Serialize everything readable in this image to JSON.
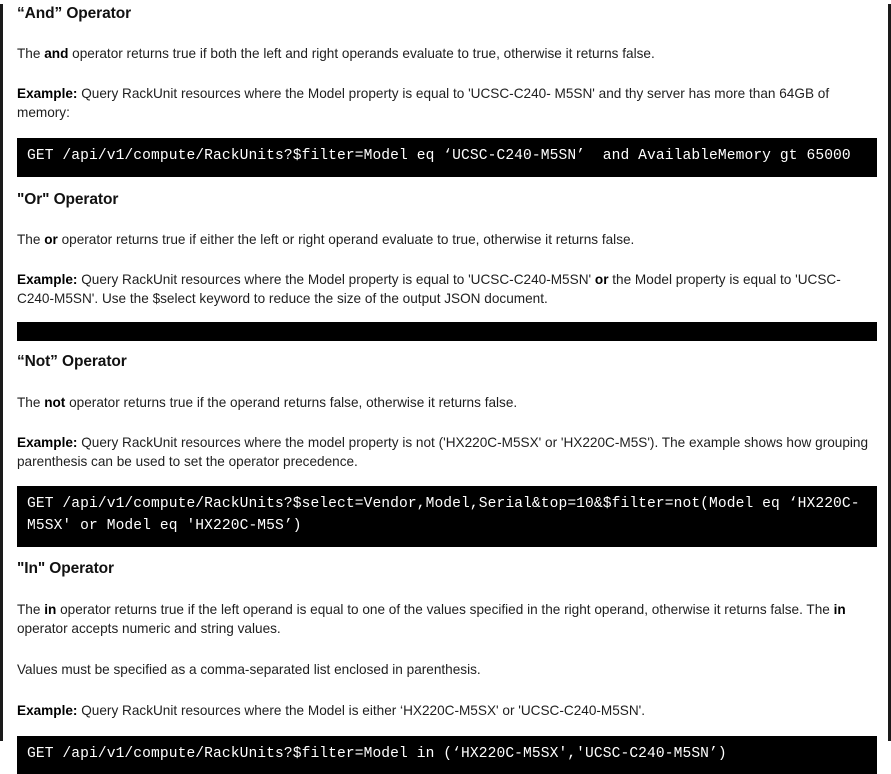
{
  "document": {
    "sections": [
      {
        "id": "and",
        "heading": "“And” Operator",
        "description_prefix": "The ",
        "description_operator": "and",
        "description_suffix": " operator returns true if both the left and right operands evaluate to true, otherwise it returns false.",
        "example_label": "Example:",
        "example_text": " Query RackUnit resources where the Model property is equal to 'UCSC-C240- M5SN' and thy server has more than 64GB of memory:",
        "code": "GET /api/v1/compute/RackUnits?$filter=Model eq ‘UCSC-C240-M5SN’  and AvailableMemory gt 65000"
      },
      {
        "id": "or",
        "heading": "\"Or\" Operator",
        "description_prefix": "The ",
        "description_operator": "or",
        "description_suffix": " operator returns true if either the left or right operand evaluate to true, otherwise it returns false.",
        "example_label": "Example:",
        "example_text_part1": " Query RackUnit resources where the Model property is equal to 'UCSC-C240-M5SN' ",
        "example_bold_operator": "or",
        "example_text_part2": " the Model property is equal to 'UCSC-C240-M5SN'. Use the $select keyword to reduce the size of the output JSON document.",
        "code": ""
      },
      {
        "id": "not",
        "heading": "“Not” Operator",
        "description_prefix": "The ",
        "description_operator": "not",
        "description_suffix": " operator returns true if the operand returns false, otherwise it returns false.",
        "example_label": "Example:",
        "example_text": " Query RackUnit resources where the model property is not ('HX220C-M5SX' or 'HX220C-M5S'). The example shows how grouping parenthesis can be used to set the operator precedence.",
        "code": "GET /api/v1/compute/RackUnits?$select=Vendor,Model,Serial&top=10&$filter=not(Model eq ‘HX220C-M5SX' or Model eq 'HX220C-M5S’)"
      },
      {
        "id": "in",
        "heading": "\"In\" Operator",
        "description_prefix": "The ",
        "description_operator": "in",
        "description_mid": " operator returns true if the left operand is equal to one of the values specified in the right operand, otherwise it returns false. The ",
        "description_operator2": "in",
        "description_suffix": " operator accepts numeric and string values.",
        "note": "Values must be specified as a comma-separated list enclosed in parenthesis.",
        "example_label": "Example:",
        "example_text": " Query RackUnit resources where the Model is either ‘HX220C-M5SX' or 'UCSC-C240-M5SN'.",
        "code": "GET /api/v1/compute/RackUnits?$filter=Model in (‘HX220C-M5SX','UCSC-C240-M5SN’)"
      }
    ]
  },
  "colors": {
    "page_background": "#ffffff",
    "text": "#1a1a1a",
    "code_background": "#000000",
    "code_text": "#ffffff",
    "border": "#1a1a1a"
  }
}
